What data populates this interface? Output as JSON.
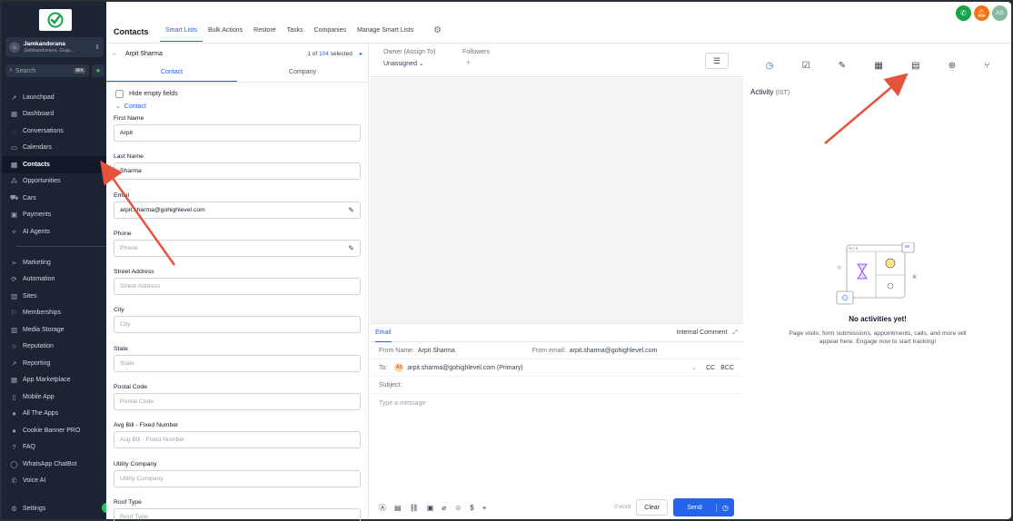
{
  "sidebar": {
    "account_name": "Jamkandorana",
    "account_location": "Jamkandorana, Guja...",
    "search_placeholder": "Search",
    "search_shortcut": "⌘K",
    "items_primary": [
      {
        "label": "Launchpad",
        "icon": "rocket-icon"
      },
      {
        "label": "Dashboard",
        "icon": "grid-icon"
      },
      {
        "label": "Conversations",
        "icon": "chat-icon"
      },
      {
        "label": "Calendars",
        "icon": "calendar-icon"
      },
      {
        "label": "Contacts",
        "icon": "contacts-icon",
        "active": true
      },
      {
        "label": "Opportunities",
        "icon": "opportunities-icon"
      },
      {
        "label": "Cars",
        "icon": "car-icon"
      },
      {
        "label": "Payments",
        "icon": "payments-icon"
      },
      {
        "label": "AI Agents",
        "icon": "ai-icon"
      }
    ],
    "items_secondary": [
      {
        "label": "Marketing",
        "icon": "send-icon"
      },
      {
        "label": "Automation",
        "icon": "automation-icon"
      },
      {
        "label": "Sites",
        "icon": "sites-icon"
      },
      {
        "label": "Memberships",
        "icon": "membership-icon"
      },
      {
        "label": "Media Storage",
        "icon": "media-icon"
      },
      {
        "label": "Reputation",
        "icon": "star-icon"
      },
      {
        "label": "Reporting",
        "icon": "chart-icon"
      },
      {
        "label": "App Marketplace",
        "icon": "marketplace-icon"
      },
      {
        "label": "Mobile App",
        "icon": "mobile-icon"
      },
      {
        "label": "All The Apps",
        "icon": "apps-icon"
      },
      {
        "label": "Cookie Banner PRO",
        "icon": "cookie-icon"
      },
      {
        "label": "FAQ",
        "icon": "question-icon"
      },
      {
        "label": "WhatsApp ChatBot",
        "icon": "whatsapp-icon"
      },
      {
        "label": "Voice AI",
        "icon": "phone-icon"
      }
    ],
    "settings_label": "Settings"
  },
  "header": {
    "title": "Contacts",
    "tabs": [
      "Smart Lists",
      "Bulk Actions",
      "Restore",
      "Tasks",
      "Companies",
      "Manage Smart Lists"
    ],
    "user_initials": "AS"
  },
  "contact": {
    "name": "Arpit Sharma",
    "pager_prefix": "1 of",
    "pager_count": "104",
    "pager_suffix": "selected",
    "subtabs": [
      "Contact",
      "Company"
    ],
    "hide_empty": "Hide empty fields",
    "section": "Contact",
    "fields": [
      {
        "label": "First Name",
        "value": "Arpit",
        "placeholder": ""
      },
      {
        "label": "Last Name",
        "value": "Sharma",
        "placeholder": ""
      },
      {
        "label": "Email",
        "value": "arpit.sharma@gohighlevel.com",
        "placeholder": ""
      },
      {
        "label": "Phone",
        "value": "",
        "placeholder": "Phone"
      },
      {
        "label": "Street Address",
        "value": "",
        "placeholder": "Street Address"
      },
      {
        "label": "City",
        "value": "",
        "placeholder": "City"
      },
      {
        "label": "State",
        "value": "",
        "placeholder": "State"
      },
      {
        "label": "Postal Code",
        "value": "",
        "placeholder": "Postal Code"
      },
      {
        "label": "Avg Bill - Fixed Number",
        "value": "",
        "placeholder": "Avg Bill - Fixed Number"
      },
      {
        "label": "Utility Company",
        "value": "",
        "placeholder": "Utility Company"
      },
      {
        "label": "Roof Type",
        "value": "",
        "placeholder": "Roof Type"
      }
    ]
  },
  "middle": {
    "owner_label": "Owner (Assign To)",
    "owner_value": "Unassigned",
    "followers_label": "Followers",
    "composer": {
      "tab": "Email",
      "internal_comment": "Internal Comment",
      "from_name_label": "From Name:",
      "from_name": "Arpit Sharma",
      "from_email_label": "From email:",
      "from_email": "arpit.sharma@gohighlevel.com",
      "to_label": "To:",
      "to_initials": "AS",
      "to_value": "arpit.sharma@gohighlevel.com (Primary)",
      "cc": "CC",
      "bcc": "BCC",
      "subject_label": "Subject:",
      "message_placeholder": "Type a message",
      "word_count": "0 word",
      "clear": "Clear",
      "send": "Send"
    }
  },
  "activity": {
    "title": "Activity",
    "tz": "(IST)",
    "empty_title": "No activities yet!",
    "empty_text": "Page visits, form submissions, appointments, calls, and more will appear here. Engage now to start tracking!"
  },
  "colors": {
    "accent": "#2563eb",
    "sidebar_bg": "#1c2434",
    "arrow": "#e5533d",
    "phone_button": "#16a34a",
    "bell_button": "#f97316",
    "avatar": "#86b8a2"
  }
}
